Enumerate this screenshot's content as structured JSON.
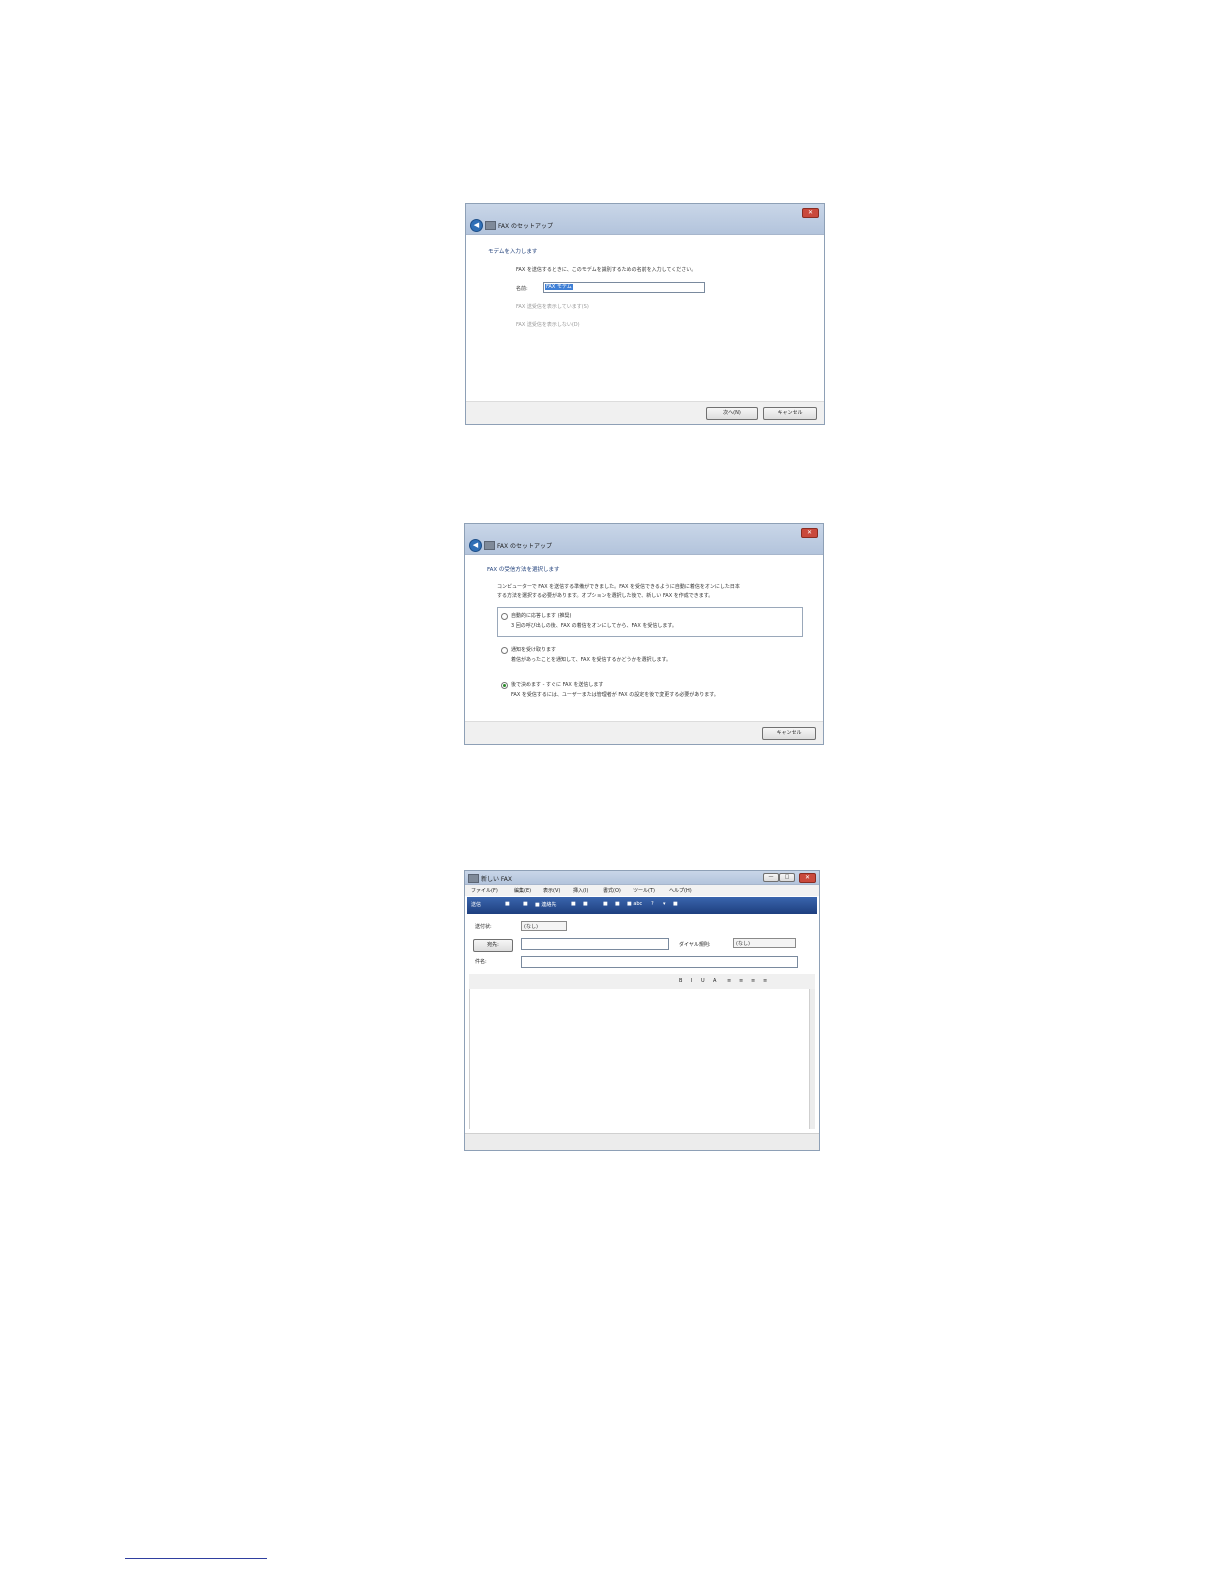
{
  "screenshots": [
    {
      "window_title": "FAX のセットアップ",
      "close_glyph": "✕",
      "back_glyph": "◀",
      "heading": "モデムを入力します",
      "instruction": "FAX を送信するときに、このモデムを識別するための名前を入力してください。",
      "name_label": "名前:",
      "name_value": "FAX モデム",
      "option_disabled_1": "FAX 送受信を表示しています(S)",
      "option_disabled_2": "FAX 送受信を表示しない(D)",
      "next_button": "次へ(N)",
      "cancel_button": "キャンセル"
    },
    {
      "window_title": "FAX のセットアップ",
      "close_glyph": "✕",
      "back_glyph": "◀",
      "heading": "FAX の受信方法を選択します",
      "intro_line1": "コンピューターで FAX を送信する準備ができました。FAX を受信できるように自動に着信をオンにした日本",
      "intro_line2": "する方法を選択する必要があります。オプションを選択した後で、新しい FAX を作成できます。",
      "options": [
        {
          "title": "自動的に応答します (推奨)",
          "desc": "3 回の呼び出しの後、FAX の着信をオンにしてから、FAX を受信します。",
          "selected": false
        },
        {
          "title": "通知を受け取ります",
          "desc": "着信があったことを通知して、FAX を受信するかどうかを選択します。",
          "selected": false
        },
        {
          "title": "後で決めます - すぐに FAX を送信します",
          "desc": "FAX を受信するには、ユーザーまたは管理者が FAX の設定を後で変更する必要があります。",
          "selected": true
        }
      ],
      "cancel_button": "キャンセル"
    },
    {
      "window_title": "新しい FAX",
      "close_glyph": "✕",
      "window_controls": [
        "—",
        "□"
      ],
      "menus": [
        "ファイル(F)",
        "編集(E)",
        "表示(V)",
        "挿入(I)",
        "書式(O)",
        "ツール(T)",
        "ヘルプ(H)"
      ],
      "toolbar_items": [
        "送信",
        "■",
        "■",
        "■ 連絡先",
        "■",
        "■",
        "■",
        "■",
        "■ abc",
        "?",
        "▾",
        "■"
      ],
      "cover_label": "送付状:",
      "cover_value": "(なし)",
      "to_button": "宛先:",
      "dialing_label": "ダイヤル規則:",
      "dialing_value": "(なし)",
      "subject_label": "件名:",
      "format_tools": [
        "B",
        "I",
        "U",
        "A",
        "≡",
        "≡",
        "≡",
        "≡"
      ]
    }
  ]
}
